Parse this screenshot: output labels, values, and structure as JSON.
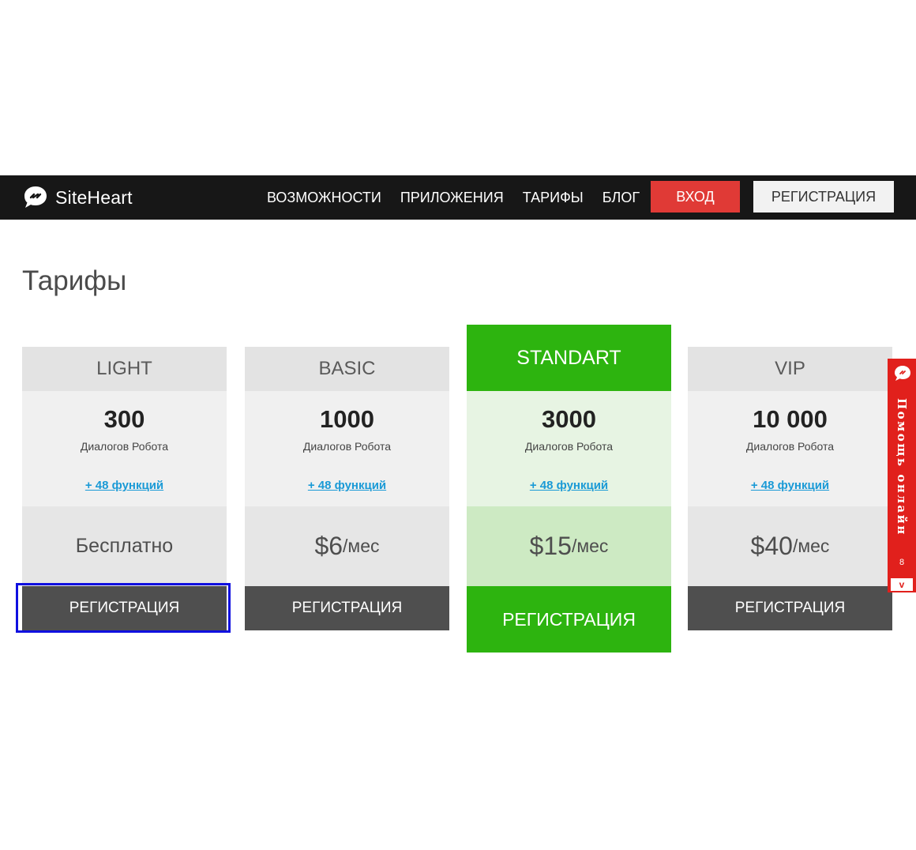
{
  "header": {
    "brand": "SiteHeart",
    "nav": [
      "ВОЗМОЖНОСТИ",
      "ПРИЛОЖЕНИЯ",
      "ТАРИФЫ",
      "БЛОГ"
    ],
    "login_label": "ВХОД",
    "register_label": "РЕГИСТРАЦИЯ"
  },
  "page": {
    "title": "Тарифы"
  },
  "plans": [
    {
      "name": "LIGHT",
      "count": "300",
      "count_label": "Диалогов Робота",
      "features": "+ 48 функций",
      "price": "Бесплатно",
      "unit": "",
      "button": "РЕГИСТРАЦИЯ"
    },
    {
      "name": "BASIC",
      "count": "1000",
      "count_label": "Диалогов Робота",
      "features": "+ 48 функций",
      "price": "$6",
      "unit": "/мес",
      "button": "РЕГИСТРАЦИЯ"
    },
    {
      "name": "STANDART",
      "count": "3000",
      "count_label": "Диалогов Робота",
      "features": "+ 48 функций",
      "price": "$15",
      "unit": "/мес",
      "button": "РЕГИСТРАЦИЯ"
    },
    {
      "name": "VIP",
      "count": "10 000",
      "count_label": "Диалогов Робота",
      "features": "+ 48 функций",
      "price": "$40",
      "unit": "/мес",
      "button": "РЕГИСТРАЦИЯ"
    }
  ],
  "help_widget": {
    "label": "Помощь онлайн",
    "count": "8",
    "toggle": "v"
  },
  "colors": {
    "accent_green": "#2db40f",
    "login_red": "#e03a36",
    "widget_red": "#e1201c",
    "link_blue": "#1a9ad6"
  }
}
